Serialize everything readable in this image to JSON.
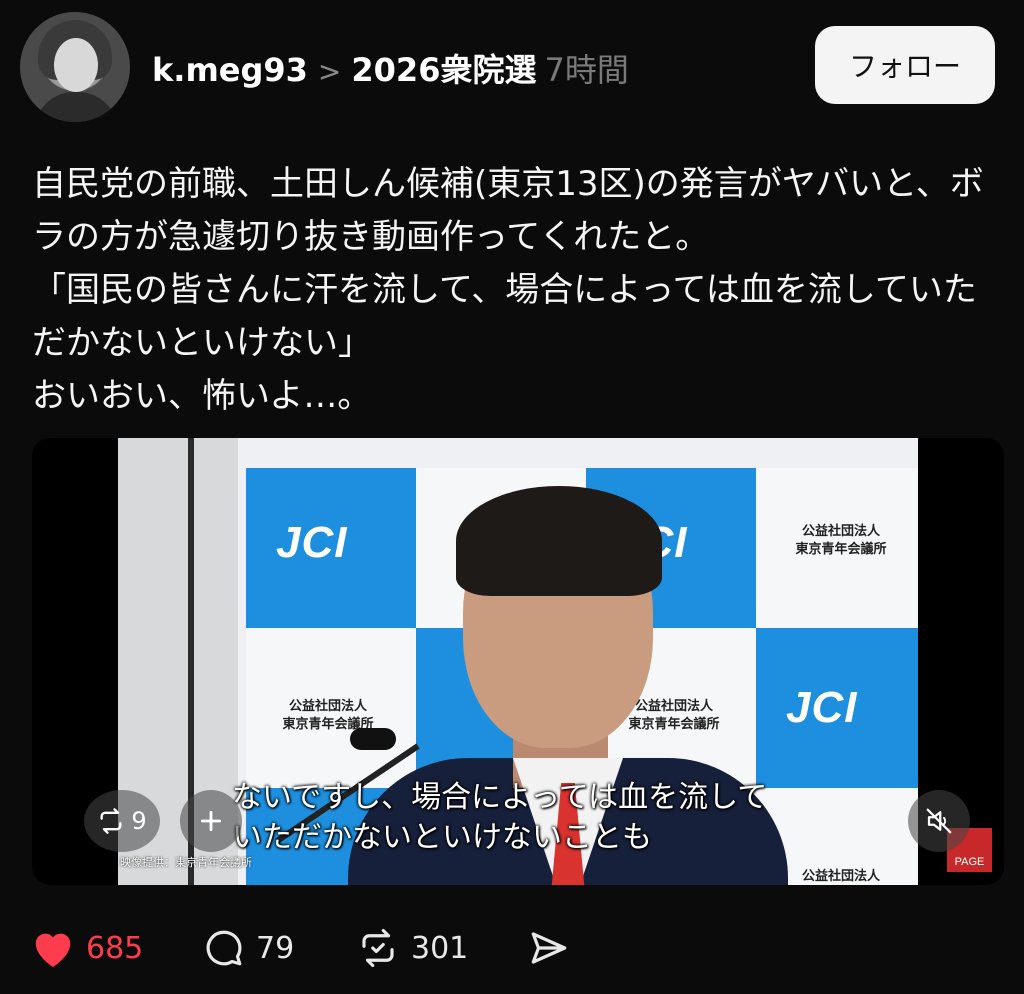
{
  "header": {
    "username": "k.meg93",
    "separator": ">",
    "topic": "2026衆院選",
    "time": "7時間",
    "follow_label": "フォロー"
  },
  "post": {
    "lines": [
      "自民党の前職、土田しん候補(東京13区)の発言がヤバいと、ボラの方が急遽切り抜き動画作ってくれたと。",
      "「国民の皆さんに汗を流して、場合によっては血を流していただかないといけない」",
      "おいおい、怖いよ…。"
    ]
  },
  "video": {
    "backdrop": {
      "logo_text": "JCI",
      "org_line1": "公益社団法人",
      "org_line2": "東京青年会議所"
    },
    "subtitle_line1": "ないですし、場合によっては血を流して",
    "subtitle_line2": "いただかないといけないことも",
    "credit": "映像提供：東京青年会議所",
    "watermark": "PAGE",
    "repost_count": "9"
  },
  "actions": {
    "likes": "685",
    "comments": "79",
    "reposts": "301"
  },
  "colors": {
    "background": "#0b0b0b",
    "like": "#ff3b4e",
    "backdrop_blue": "#1e8fde"
  }
}
